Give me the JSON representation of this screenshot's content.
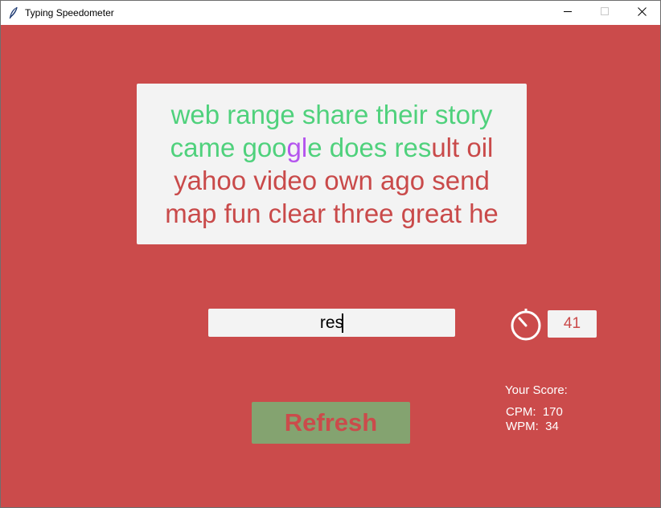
{
  "window": {
    "title": "Typing Speedometer",
    "background": "#cb4b4b"
  },
  "passage": {
    "lines": [
      [
        {
          "text": "web range share their story",
          "state": "done"
        }
      ],
      [
        {
          "text": "came goo",
          "state": "done"
        },
        {
          "text": "gl",
          "state": "current"
        },
        {
          "text": "e does res",
          "state": "done"
        },
        {
          "text": "ult oil",
          "state": "todo"
        }
      ],
      [
        {
          "text": "yahoo video own ago send",
          "state": "todo"
        }
      ],
      [
        {
          "text": "map fun clear three great he",
          "state": "todo"
        }
      ]
    ],
    "colors": {
      "done": "#4fd17c",
      "todo": "#c94a4a",
      "current": "#b454ee"
    }
  },
  "input": {
    "value": "res"
  },
  "timer": {
    "icon": "stopwatch-icon",
    "seconds": "41"
  },
  "actions": {
    "refresh_label": "Refresh"
  },
  "score": {
    "title": "Your Score:",
    "cpm_label": "CPM:",
    "cpm_value": "170",
    "wpm_label": "WPM:",
    "wpm_value": "34"
  }
}
